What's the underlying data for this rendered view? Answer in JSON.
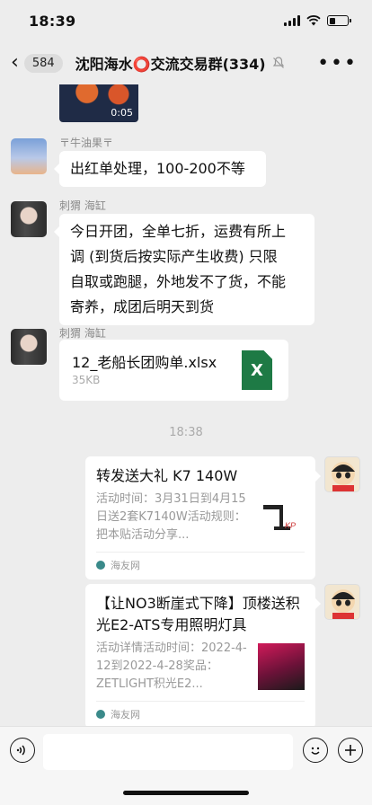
{
  "status_bar": {
    "time": "18:39"
  },
  "nav": {
    "unread_count": "584",
    "title": "沈阳海水⭕交流交易群(334)"
  },
  "messages": {
    "video_duration": "0:05",
    "m1": {
      "sender": "〒牛油果〒",
      "text": "出红单处理，100-200不等"
    },
    "m2": {
      "sender": "刺猬 海缸",
      "lines": [
        "今日开团，全单七折，运费有所上",
        "调 (到货后按实际产生收费) 只限",
        "自取或跑腿，外地发不了货，不能",
        "寄养，成团后明天到货"
      ]
    },
    "m3": {
      "sender": "刺猬 海缸",
      "file_name": "12_老船长团购单.xlsx",
      "file_size": "35KB",
      "file_icon": "X"
    },
    "time_divider": "18:38",
    "link1": {
      "title": "转发送大礼 K7 140W",
      "desc": "活动时间：3月31日到4月15日送2套K7140W活动规则：把本贴活动分享...",
      "source": "海友网"
    },
    "link2": {
      "title": "【让NO3断崖式下降】顶楼送积光E2-ATS专用照明灯具",
      "desc": "活动详情活动时间：2022-4-12到2022-4-28奖品：ZETLIGHT积光E2...",
      "source": "海友网"
    }
  },
  "input_bar": {
    "placeholder": ""
  }
}
